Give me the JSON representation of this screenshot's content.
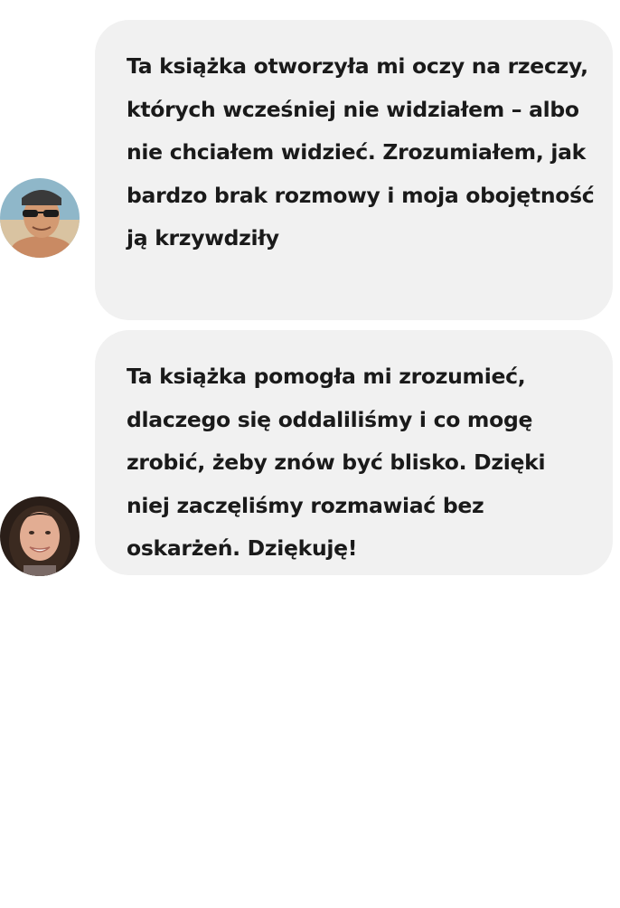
{
  "messages": [
    {
      "avatar": "man-with-sunglasses-avatar",
      "text": "Ta książka otworzyła mi oczy na rzeczy, których wcześniej nie widziałem – albo nie chciałem widzieć. Zrozumiałem, jak bardzo brak rozmowy i moja obojętność ją krzywdziły"
    },
    {
      "avatar": "smiling-woman-avatar",
      "text": "Ta książka pomogła mi zrozumieć, dlaczego się oddaliliśmy i co mogę zrobić, żeby znów być blisko. Dzięki niej zaczęliśmy rozmawiać bez oskarżeń. Dziękuję!"
    }
  ],
  "colors": {
    "bubble": "#f1f1f1",
    "text": "#1a1a1a",
    "background": "#ffffff"
  }
}
